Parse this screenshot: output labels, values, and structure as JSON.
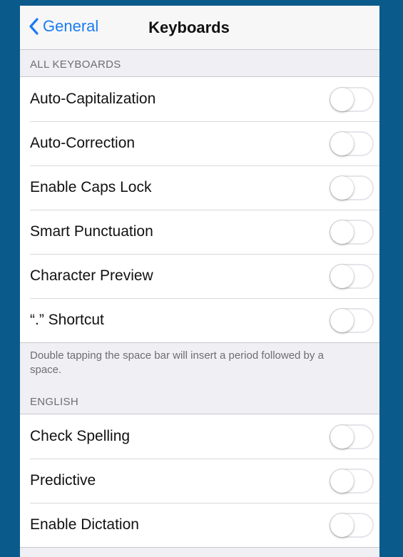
{
  "nav": {
    "back_label": "General",
    "title": "Keyboards"
  },
  "all_keyboards": {
    "header": "ALL KEYBOARDS",
    "items": [
      {
        "label": "Auto-Capitalization",
        "on": false
      },
      {
        "label": "Auto-Correction",
        "on": false
      },
      {
        "label": "Enable Caps Lock",
        "on": false
      },
      {
        "label": "Smart Punctuation",
        "on": false
      },
      {
        "label": "Character Preview",
        "on": false
      },
      {
        "label": "“.” Shortcut",
        "on": false
      }
    ],
    "footer": "Double tapping the space bar will insert a period followed by a space."
  },
  "english": {
    "header": "ENGLISH",
    "items": [
      {
        "label": "Check Spelling",
        "on": false
      },
      {
        "label": "Predictive",
        "on": false
      },
      {
        "label": "Enable Dictation",
        "on": false
      }
    ]
  },
  "colors": {
    "accent": "#1a7cf2",
    "frame": "#0b5a8c",
    "group_background": "#efeff4"
  }
}
